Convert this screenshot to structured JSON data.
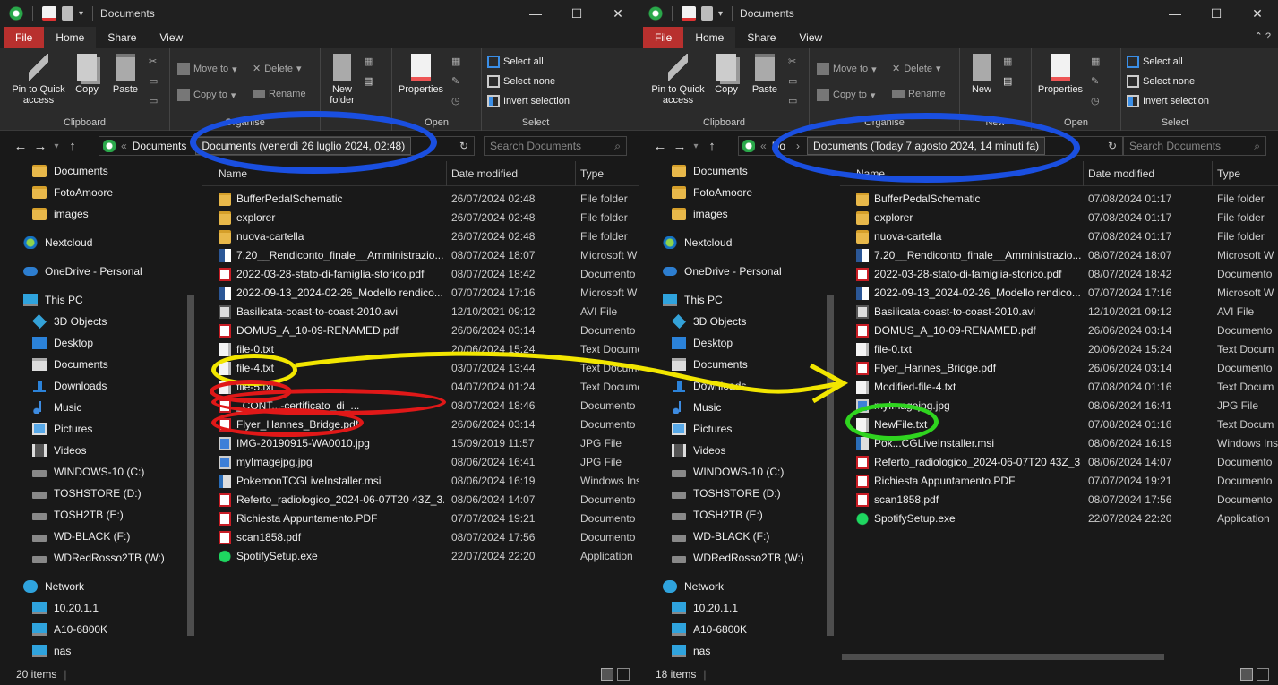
{
  "left": {
    "title": "Documents",
    "tabs": {
      "file": "File",
      "home": "Home",
      "share": "Share",
      "view": "View"
    },
    "ribbon": {
      "pin": "Pin to Quick access",
      "copy": "Copy",
      "paste": "Paste",
      "move_to": "Move to",
      "copy_to": "Copy to",
      "delete": "Delete",
      "rename": "Rename",
      "new_folder": "New folder",
      "properties": "Properties",
      "select_all": "Select all",
      "select_none": "Select none",
      "invert_selection": "Invert selection",
      "clipboard": "Clipboard",
      "organise": "Organise",
      "open": "Open",
      "select": "Select"
    },
    "address": {
      "crumb": "Documents",
      "tooltip": "Documents (venerdì 26 luglio 2024, 02:48)",
      "prefix": "«"
    },
    "search_placeholder": "Search Documents",
    "tree": [
      "Documents",
      "FotoAmoore",
      "images",
      "Nextcloud",
      "OneDrive - Personal",
      "This PC",
      "3D Objects",
      "Desktop",
      "Documents",
      "Downloads",
      "Music",
      "Pictures",
      "Videos",
      "WINDOWS-10 (C:)",
      "TOSHSTORE (D:)",
      "TOSH2TB (E:)",
      "WD-BLACK (F:)",
      "WDRedRosso2TB (W:)",
      "Network",
      "10.20.1.1",
      "A10-6800K",
      "nas"
    ],
    "columns": {
      "name": "Name",
      "date": "Date modified",
      "type": "Type"
    },
    "files": [
      {
        "name": "BufferPedalSchematic",
        "date": "26/07/2024 02:48",
        "type": "File folder",
        "icon": "folder"
      },
      {
        "name": "explorer",
        "date": "26/07/2024 02:48",
        "type": "File folder",
        "icon": "folder"
      },
      {
        "name": "nuova-cartella",
        "date": "26/07/2024 02:48",
        "type": "File folder",
        "icon": "folder"
      },
      {
        "name": "7.20__Rendiconto_finale__Amministrazio...",
        "date": "08/07/2024 18:07",
        "type": "Microsoft W",
        "icon": "word"
      },
      {
        "name": "2022-03-28-stato-di-famiglia-storico.pdf",
        "date": "08/07/2024 18:42",
        "type": "Documento",
        "icon": "pdf"
      },
      {
        "name": "2022-09-13_2024-02-26_Modello rendico...",
        "date": "07/07/2024 17:16",
        "type": "Microsoft W",
        "icon": "word"
      },
      {
        "name": "Basilicata-coast-to-coast-2010.avi",
        "date": "12/10/2021 09:12",
        "type": "AVI File",
        "icon": "avi"
      },
      {
        "name": "DOMUS_A_10-09-RENAMED.pdf",
        "date": "26/06/2024 03:14",
        "type": "Documento",
        "icon": "pdf"
      },
      {
        "name": "file-0.txt",
        "date": "20/06/2024 15:24",
        "type": "Text Docume",
        "icon": "txt"
      },
      {
        "name": "file-4.txt",
        "date": "03/07/2024 13:44",
        "type": "Text Docume",
        "icon": "txt"
      },
      {
        "name": "file-5.txt",
        "date": "04/07/2024 01:24",
        "type": "Text Docume",
        "icon": "txt"
      },
      {
        "name": "_CONT...-certificato_di_...",
        "date": "08/07/2024 18:46",
        "type": "Documento",
        "icon": "pdf"
      },
      {
        "name": "Flyer_Hannes_Bridge.pdf",
        "date": "26/06/2024 03:14",
        "type": "Documento",
        "icon": "pdf"
      },
      {
        "name": "IMG-20190915-WA0010.jpg",
        "date": "15/09/2019 11:57",
        "type": "JPG File",
        "icon": "jpg"
      },
      {
        "name": "myImagejpg.jpg",
        "date": "08/06/2024 16:41",
        "type": "JPG File",
        "icon": "jpg"
      },
      {
        "name": "PokemonTCGLiveInstaller.msi",
        "date": "08/06/2024 16:19",
        "type": "Windows Ins",
        "icon": "msi"
      },
      {
        "name": "Referto_radiologico_2024-06-07T20 43Z_3...",
        "date": "08/06/2024 14:07",
        "type": "Documento",
        "icon": "pdf"
      },
      {
        "name": "Richiesta Appuntamento.PDF",
        "date": "07/07/2024 19:21",
        "type": "Documento",
        "icon": "pdf"
      },
      {
        "name": "scan1858.pdf",
        "date": "08/07/2024 17:56",
        "type": "Documento",
        "icon": "pdf"
      },
      {
        "name": "SpotifySetup.exe",
        "date": "22/07/2024 22:20",
        "type": "Application",
        "icon": "exe"
      }
    ],
    "status": "20 items"
  },
  "right": {
    "title": "Documents",
    "tabs": {
      "file": "File",
      "home": "Home",
      "share": "Share",
      "view": "View"
    },
    "ribbon": {
      "pin": "Pin to Quick access",
      "copy": "Copy",
      "paste": "Paste",
      "move_to": "Move to",
      "copy_to": "Copy to",
      "delete": "Delete",
      "rename": "Rename",
      "new_folder": "New",
      "properties": "Properties",
      "select_all": "Select all",
      "select_none": "Select none",
      "invert_selection": "Invert selection",
      "clipboard": "Clipboard",
      "organise": "Organise",
      "new": "New",
      "open": "Open",
      "select": "Select"
    },
    "address": {
      "crumb": "Do",
      "tooltip": "Documents (Today 7 agosto 2024, 14 minuti fa)",
      "prefix": "«"
    },
    "search_placeholder": "Search Documents",
    "tree": [
      "Documents",
      "FotoAmoore",
      "images",
      "Nextcloud",
      "OneDrive - Personal",
      "This PC",
      "3D Objects",
      "Desktop",
      "Documents",
      "Downloads",
      "Music",
      "Pictures",
      "Videos",
      "WINDOWS-10 (C:)",
      "TOSHSTORE (D:)",
      "TOSH2TB (E:)",
      "WD-BLACK (F:)",
      "WDRedRosso2TB (W:)",
      "Network",
      "10.20.1.1",
      "A10-6800K",
      "nas"
    ],
    "columns": {
      "name": "Name",
      "date": "Date modified",
      "type": "Type"
    },
    "files": [
      {
        "name": "BufferPedalSchematic",
        "date": "07/08/2024 01:17",
        "type": "File folder",
        "icon": "folder"
      },
      {
        "name": "explorer",
        "date": "07/08/2024 01:17",
        "type": "File folder",
        "icon": "folder"
      },
      {
        "name": "nuova-cartella",
        "date": "07/08/2024 01:17",
        "type": "File folder",
        "icon": "folder"
      },
      {
        "name": "7.20__Rendiconto_finale__Amministrazio...",
        "date": "08/07/2024 18:07",
        "type": "Microsoft W",
        "icon": "word"
      },
      {
        "name": "2022-03-28-stato-di-famiglia-storico.pdf",
        "date": "08/07/2024 18:42",
        "type": "Documento",
        "icon": "pdf"
      },
      {
        "name": "2022-09-13_2024-02-26_Modello rendico...",
        "date": "07/07/2024 17:16",
        "type": "Microsoft W",
        "icon": "word"
      },
      {
        "name": "Basilicata-coast-to-coast-2010.avi",
        "date": "12/10/2021 09:12",
        "type": "AVI File",
        "icon": "avi"
      },
      {
        "name": "DOMUS_A_10-09-RENAMED.pdf",
        "date": "26/06/2024 03:14",
        "type": "Documento",
        "icon": "pdf"
      },
      {
        "name": "file-0.txt",
        "date": "20/06/2024 15:24",
        "type": "Text Docum",
        "icon": "txt"
      },
      {
        "name": "Flyer_Hannes_Bridge.pdf",
        "date": "26/06/2024 03:14",
        "type": "Documento",
        "icon": "pdf"
      },
      {
        "name": "Modified-file-4.txt",
        "date": "07/08/2024 01:16",
        "type": "Text Docum",
        "icon": "txt"
      },
      {
        "name": "myImagejpg.jpg",
        "date": "08/06/2024 16:41",
        "type": "JPG File",
        "icon": "jpg"
      },
      {
        "name": "NewFile.txt",
        "date": "07/08/2024 01:16",
        "type": "Text Docum",
        "icon": "txt"
      },
      {
        "name": "Pok...CGLiveInstaller.msi",
        "date": "08/06/2024 16:19",
        "type": "Windows Ins",
        "icon": "msi"
      },
      {
        "name": "Referto_radiologico_2024-06-07T20 43Z_3...",
        "date": "08/06/2024 14:07",
        "type": "Documento",
        "icon": "pdf"
      },
      {
        "name": "Richiesta Appuntamento.PDF",
        "date": "07/07/2024 19:21",
        "type": "Documento",
        "icon": "pdf"
      },
      {
        "name": "scan1858.pdf",
        "date": "08/07/2024 17:56",
        "type": "Documento",
        "icon": "pdf"
      },
      {
        "name": "SpotifySetup.exe",
        "date": "22/07/2024 22:20",
        "type": "Application",
        "icon": "exe"
      }
    ],
    "status": "18 items"
  },
  "annotations": {
    "blue": "#1a4fe0",
    "yellow": "#f2e600",
    "red": "#e01818",
    "green": "#2fd41f"
  }
}
